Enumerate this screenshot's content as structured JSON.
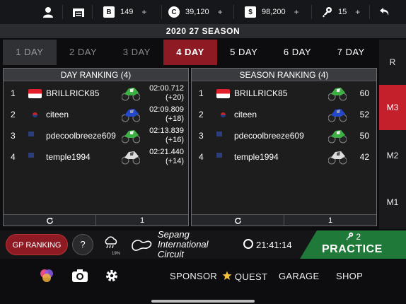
{
  "topbar": {
    "items": [
      {
        "icon": "user-icon"
      },
      {
        "icon": "garage-icon"
      },
      {
        "icon": "coin-b-icon",
        "value": "149",
        "plus": "+"
      },
      {
        "icon": "coin-c-icon",
        "value": "39,120",
        "plus": "+"
      },
      {
        "icon": "dollar-icon",
        "value": "98,200",
        "plus": "+"
      },
      {
        "icon": "key-icon",
        "value": "15",
        "plus": "+"
      },
      {
        "icon": "back-icon"
      }
    ]
  },
  "season_title": "2020 27 SEASON",
  "day_tabs": [
    "1 DAY",
    "2 DAY",
    "3 DAY",
    "4 DAY",
    "5 DAY",
    "6 DAY",
    "7 DAY"
  ],
  "active_day_index": 3,
  "league_tabs": [
    "R",
    "M3",
    "M2",
    "M1"
  ],
  "active_league_index": 1,
  "day_ranking": {
    "title": "DAY RANKING (4)",
    "rows": [
      {
        "rank": "1",
        "flag": "ID",
        "name": "BRILLRICK85",
        "bike": "green",
        "time": "02:00.712",
        "gap": "(+20)"
      },
      {
        "rank": "2",
        "flag": "KR",
        "name": "citeen",
        "bike": "blue",
        "time": "02:09.809",
        "gap": "(+18)"
      },
      {
        "rank": "3",
        "flag": "US",
        "name": "pdecoolbreeze609",
        "bike": "green",
        "time": "02:13.839",
        "gap": "(+16)"
      },
      {
        "rank": "4",
        "flag": "US",
        "name": "temple1994",
        "bike": "white",
        "time": "02:21.440",
        "gap": "(+14)"
      }
    ],
    "footer_page": "1"
  },
  "season_ranking": {
    "title": "SEASON RANKING (4)",
    "rows": [
      {
        "rank": "1",
        "flag": "ID",
        "name": "BRILLRICK85",
        "bike": "green",
        "points": "60"
      },
      {
        "rank": "2",
        "flag": "KR",
        "name": "citeen",
        "bike": "blue",
        "points": "52"
      },
      {
        "rank": "3",
        "flag": "US",
        "name": "pdecoolbreeze609",
        "bike": "green",
        "points": "50"
      },
      {
        "rank": "4",
        "flag": "US",
        "name": "temple1994",
        "bike": "white",
        "points": "42"
      }
    ],
    "footer_page": "1"
  },
  "info": {
    "gp_ranking_label": "GP RANKING",
    "help_label": "?",
    "rain_chance": "19%",
    "circuit_name": "Sepang International Circuit",
    "clock": "21:41:14"
  },
  "practice": {
    "keys": "2",
    "label": "PRACTICE"
  },
  "bottom_nav": {
    "sponsor": "SPONSOR",
    "quest": "QUEST",
    "garage": "GARAGE",
    "shop": "SHOP"
  },
  "colors": {
    "accent_red": "#8e1b24",
    "league_active": "#c4202c",
    "practice_green": "#1f7a3a"
  }
}
